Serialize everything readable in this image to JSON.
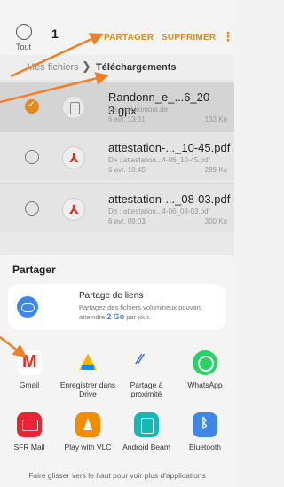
{
  "toolbar": {
    "select_all_label": "Tout",
    "selected_count": "1",
    "share_label": "PARTAGER",
    "delete_label": "SUPPRIMER",
    "more_label": "⋮"
  },
  "breadcrumb": {
    "root": "Mes fichiers",
    "separator": "❯",
    "current": "Téléchargements"
  },
  "files": [
    {
      "name": "Randonn_e_...6_20-3.gpx",
      "source": "De : api.komoot.de",
      "date": "6 avr. 13:31",
      "size": "133 Ko",
      "checked": true
    },
    {
      "name": "attestation-..._10-45.pdf",
      "source": "De : attestation...4-06_10-45.pdf",
      "date": "6 avr. 10:45",
      "size": "299 Ko",
      "checked": false
    },
    {
      "name": "attestation-..._08-03.pdf",
      "source": "De : attestation...4-06_08-03.pdf",
      "date": "6 avr. 08:03",
      "size": "300 Ko",
      "checked": false
    }
  ],
  "share_sheet": {
    "title": "Partager",
    "link_share": {
      "title": "Partage de liens",
      "desc_before": "Partagez des fichiers volumineux pouvant atteindre ",
      "desc_bold": "2 Go",
      "desc_after": " par jour."
    },
    "apps": [
      {
        "label": "Gmail",
        "icon": "gmail-icon"
      },
      {
        "label": "Enregistrer dans Drive",
        "icon": "drive-icon"
      },
      {
        "label": "Partage à proximité",
        "icon": "nearby-share-icon"
      },
      {
        "label": "WhatsApp",
        "icon": "whatsapp-icon"
      },
      {
        "label": "SFR Mail",
        "icon": "sfr-mail-icon"
      },
      {
        "label": "Play with VLC",
        "icon": "vlc-icon"
      },
      {
        "label": "Android Beam",
        "icon": "android-beam-icon"
      },
      {
        "label": "Bluetooth",
        "icon": "bluetooth-icon"
      }
    ],
    "footer": "Faire glisser vers le haut pour voir plus d'applications"
  },
  "colors": {
    "accent": "#e08a1e",
    "annotation_arrow": "#f07f2a",
    "link_blue": "#3f86e6"
  }
}
